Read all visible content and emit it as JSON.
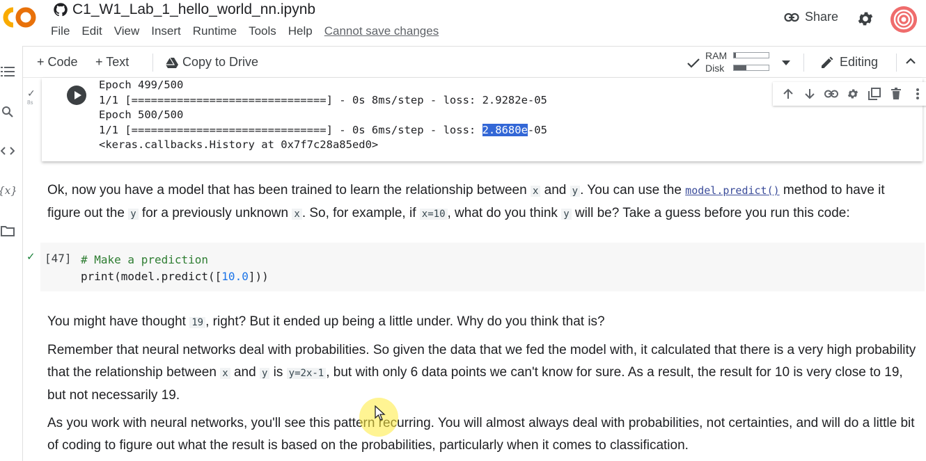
{
  "app": {
    "logo_text": "CO",
    "notebook_title": "C1_W1_Lab_1_hello_world_nn.ipynb",
    "menu": [
      "File",
      "Edit",
      "View",
      "Insert",
      "Runtime",
      "Tools",
      "Help"
    ],
    "save_notice": "Cannot save changes",
    "share_label": "Share"
  },
  "toolbar": {
    "add_code": "+ Code",
    "add_text": "+ Text",
    "copy_to_drive": "Copy to Drive",
    "ram_label": "RAM",
    "disk_label": "Disk",
    "ram_usage": 0.05,
    "disk_usage": 0.35,
    "editing_label": "Editing"
  },
  "output_cell": {
    "exec_time": "8s",
    "lines": [
      "Epoch 499/500",
      "1/1 [==============================] - 0s 8ms/step - loss: 2.9282e-05",
      "Epoch 500/500"
    ],
    "last_line_prefix": "1/1 [==============================] - 0s 6ms/step - loss: ",
    "last_line_highlight": "2.8680e",
    "last_line_suffix": "-05",
    "history_line": "<keras.callbacks.History at 0x7f7c28a85ed0>"
  },
  "text1": {
    "p1_a": "Ok, now you have a model that has been trained to learn the relationship between ",
    "code_x": "x",
    "p1_b": " and ",
    "code_y": "y",
    "p1_c": ". You can use the ",
    "link": "model.predict()",
    "p1_d": " method to have it figure out the ",
    "p1_e": " for a previously unknown ",
    "p1_f": ". So, for example, if ",
    "code_x10": "x=10",
    "p1_g": ", what do you think ",
    "p1_h": " will be? Take a guess before you run this code:"
  },
  "code_cell": {
    "exec_count": "[47]",
    "comment": "# Make a prediction",
    "line2_a": "print(model.predict([",
    "line2_num": "10.0",
    "line2_b": "]))"
  },
  "text2": {
    "p1_a": "You might have thought ",
    "code_19": "19",
    "p1_b": ", right? But it ended up being a little under. Why do you think that is?",
    "p2_a": "Remember that neural networks deal with probabilities. So given the data that we fed the model with, it calculated that there is a very high probability that the relationship between ",
    "code_x": "x",
    "p2_b": " and ",
    "code_y": "y",
    "p2_c": " is ",
    "code_eq": "y=2x-1",
    "p2_d": ", but with only 6 data points we can't know for sure. As a result, the result for 10 is very close to 19, but not necessarily 19.",
    "p3": "As you work with neural networks, you'll see this pattern recurring. You will almost always deal with probabilities, not certainties, and will do a little bit of coding to figure out what the result is based on the probabilities, particularly when it comes to classification."
  }
}
